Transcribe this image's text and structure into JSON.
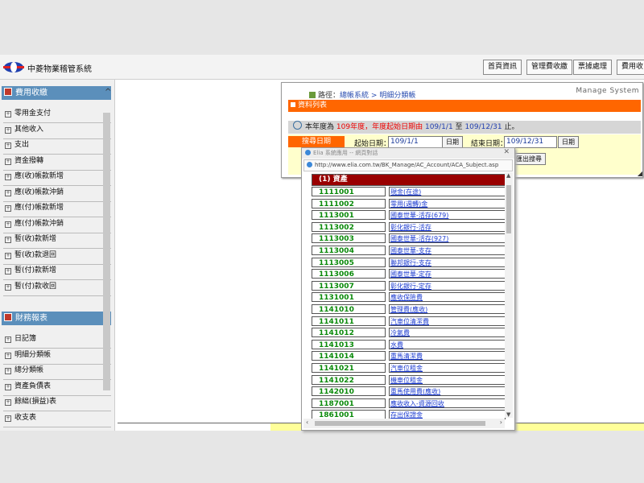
{
  "app": {
    "title": "中菱物業稽管系統"
  },
  "nav": {
    "items": [
      "首頁資訊",
      "管理費收繳",
      "票據處理",
      "費用收"
    ]
  },
  "sidebar": {
    "sections": [
      {
        "title": "費用收繳",
        "items": [
          "零用金支付",
          "其他收入",
          "支出",
          "資金撥轉",
          "應(收)帳款新增",
          "應(收)帳款沖銷",
          "應(付)帳款新增",
          "應(付)帳款沖銷",
          "暫(收)款新增",
          "暫(收)款退回",
          "暫(付)款新增",
          "暫(付)款收回"
        ]
      },
      {
        "title": "財務報表",
        "items": [
          "日記簿",
          "明細分類帳",
          "總分類帳",
          "資產負債表",
          "餘絀(損益)表",
          "收支表"
        ]
      }
    ]
  },
  "panel": {
    "breadcrumb_prefix": "路徑：",
    "breadcrumb_parent": "總帳系統",
    "breadcrumb_sep": ">",
    "breadcrumb_current": "明細分類帳",
    "manage_system": "Manage System",
    "list_title": "資料列表",
    "year_text_1": "本年度為",
    "year_value": "109",
    "year_text_2": "年度，年度起始日期由",
    "year_start": "109/1/1",
    "year_text_3": "至",
    "year_end": "109/12/31",
    "year_text_4": "止。",
    "search_label": "搜尋日期",
    "start_label": "起始日期：",
    "start_value": "109/1/1",
    "end_label": "結束日期：",
    "end_value": "109/12/31",
    "date_btn": "日期",
    "export_btn": "匯出搜尋"
  },
  "popup": {
    "title": "Elia 系統應用 -- 網頁對話",
    "url": "http://www.elia.com.tw/BK_Manage/AC_Account/ACA_Subject.asp",
    "header": "(1) 資產",
    "rows": [
      {
        "code": "1111001",
        "name": "現金(在途)"
      },
      {
        "code": "1111002",
        "name": "零用(週轉)金"
      },
      {
        "code": "1113001",
        "name": "國泰世華-活存(679)"
      },
      {
        "code": "1113002",
        "name": "彰化銀行-活存"
      },
      {
        "code": "1113003",
        "name": "國泰世華-活存(927)"
      },
      {
        "code": "1113004",
        "name": "國泰世華-支存"
      },
      {
        "code": "1113005",
        "name": "聯邦銀行-支存"
      },
      {
        "code": "1113006",
        "name": "國泰世華-定存"
      },
      {
        "code": "1113007",
        "name": "彰化銀行-定存"
      },
      {
        "code": "1131001",
        "name": "應收保險費"
      },
      {
        "code": "1141010",
        "name": "管理費(應收)"
      },
      {
        "code": "1141011",
        "name": "汽車位清潔費"
      },
      {
        "code": "1141012",
        "name": "冷氣費"
      },
      {
        "code": "1141013",
        "name": "水費"
      },
      {
        "code": "1141014",
        "name": "重馬清潔費"
      },
      {
        "code": "1141021",
        "name": "汽車位租金"
      },
      {
        "code": "1141022",
        "name": "機車位租金"
      },
      {
        "code": "1142010",
        "name": "重馬使用費(應收)"
      },
      {
        "code": "1187001",
        "name": "應收收入-資源回收"
      },
      {
        "code": "1861001",
        "name": "存出保證金"
      }
    ]
  },
  "colors": {
    "accent": "#ff6600",
    "sidebar_head": "#5b8fbb",
    "popup_head": "#990000",
    "code_green": "#0a8a0a",
    "link_blue": "#1a3ad0"
  }
}
